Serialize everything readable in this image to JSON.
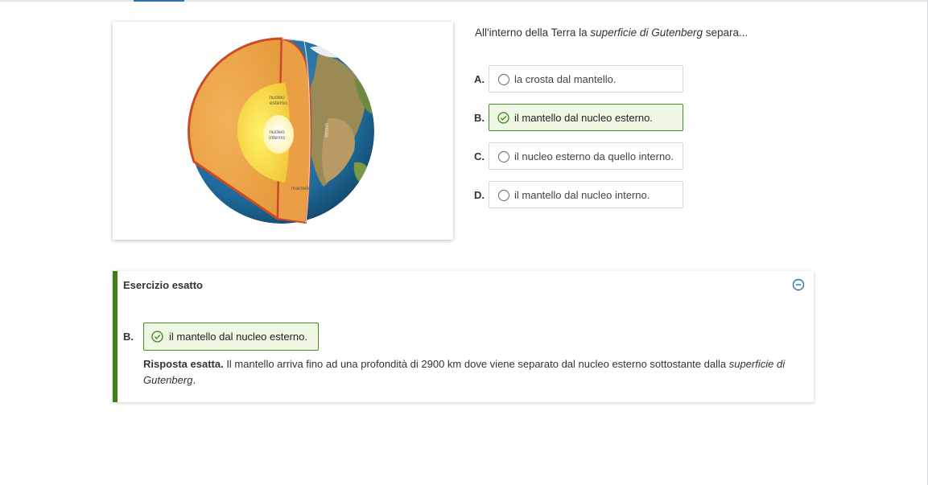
{
  "question": {
    "text_before": "All'interno della Terra la ",
    "text_italic": "superficie di Gutenberg",
    "text_after": " separa..."
  },
  "figure": {
    "labels": {
      "nucleo_esterno_1": "nucleo",
      "nucleo_esterno_2": "esterno",
      "nucleo_interno_1": "nucleo",
      "nucleo_interno_2": "interno",
      "crosta": "crosta",
      "mantello": "mantello"
    }
  },
  "options": [
    {
      "letter": "A.",
      "label": "la crosta dal mantello.",
      "icon": "radio-icon",
      "selected": false
    },
    {
      "letter": "B.",
      "label": "il mantello dal nucleo esterno.",
      "icon": "check-circle-icon",
      "selected": true
    },
    {
      "letter": "C.",
      "label": "il nucleo esterno da quello interno.",
      "icon": "radio-icon",
      "selected": false
    },
    {
      "letter": "D.",
      "label": "il mantello dal nucleo interno.",
      "icon": "radio-icon",
      "selected": false
    }
  ],
  "feedback": {
    "title": "Esercizio esatto",
    "collapse_icon": "minus-circle-icon",
    "answer_letter": "B.",
    "answer_label": "il mantello dal nucleo esterno.",
    "explanation_bold": "Risposta esatta.",
    "explanation_text": " Il mantello arriva fino ad una profondità di 2900 km dove viene separato dal nucleo esterno sottostante dalla ",
    "explanation_italic": "superficie di Gutenberg",
    "explanation_end": "."
  },
  "colors": {
    "correct_border": "#4c8a22",
    "correct_bg": "#eef7e4",
    "accent_blue": "#2f6fb2",
    "panel_accent": "#3f7f17"
  }
}
